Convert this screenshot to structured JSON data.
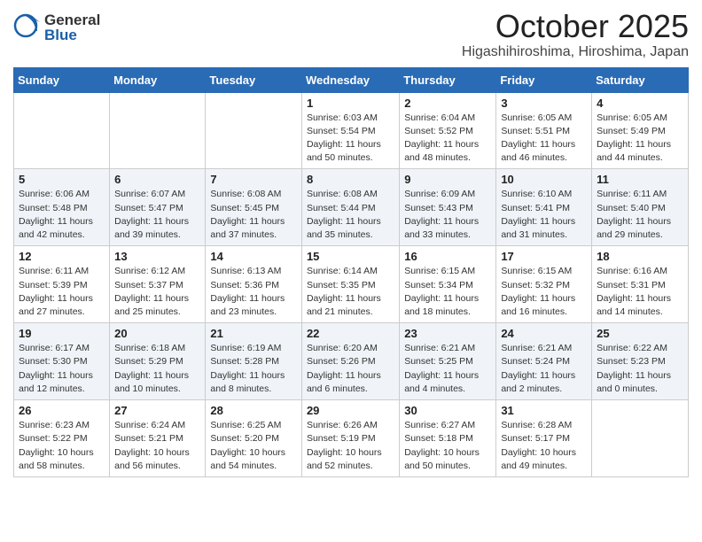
{
  "logo": {
    "general": "General",
    "blue": "Blue"
  },
  "title": "October 2025",
  "location": "Higashihiroshima, Hiroshima, Japan",
  "weekdays": [
    "Sunday",
    "Monday",
    "Tuesday",
    "Wednesday",
    "Thursday",
    "Friday",
    "Saturday"
  ],
  "weeks": [
    [
      {
        "day": "",
        "info": ""
      },
      {
        "day": "",
        "info": ""
      },
      {
        "day": "",
        "info": ""
      },
      {
        "day": "1",
        "info": "Sunrise: 6:03 AM\nSunset: 5:54 PM\nDaylight: 11 hours\nand 50 minutes."
      },
      {
        "day": "2",
        "info": "Sunrise: 6:04 AM\nSunset: 5:52 PM\nDaylight: 11 hours\nand 48 minutes."
      },
      {
        "day": "3",
        "info": "Sunrise: 6:05 AM\nSunset: 5:51 PM\nDaylight: 11 hours\nand 46 minutes."
      },
      {
        "day": "4",
        "info": "Sunrise: 6:05 AM\nSunset: 5:49 PM\nDaylight: 11 hours\nand 44 minutes."
      }
    ],
    [
      {
        "day": "5",
        "info": "Sunrise: 6:06 AM\nSunset: 5:48 PM\nDaylight: 11 hours\nand 42 minutes."
      },
      {
        "day": "6",
        "info": "Sunrise: 6:07 AM\nSunset: 5:47 PM\nDaylight: 11 hours\nand 39 minutes."
      },
      {
        "day": "7",
        "info": "Sunrise: 6:08 AM\nSunset: 5:45 PM\nDaylight: 11 hours\nand 37 minutes."
      },
      {
        "day": "8",
        "info": "Sunrise: 6:08 AM\nSunset: 5:44 PM\nDaylight: 11 hours\nand 35 minutes."
      },
      {
        "day": "9",
        "info": "Sunrise: 6:09 AM\nSunset: 5:43 PM\nDaylight: 11 hours\nand 33 minutes."
      },
      {
        "day": "10",
        "info": "Sunrise: 6:10 AM\nSunset: 5:41 PM\nDaylight: 11 hours\nand 31 minutes."
      },
      {
        "day": "11",
        "info": "Sunrise: 6:11 AM\nSunset: 5:40 PM\nDaylight: 11 hours\nand 29 minutes."
      }
    ],
    [
      {
        "day": "12",
        "info": "Sunrise: 6:11 AM\nSunset: 5:39 PM\nDaylight: 11 hours\nand 27 minutes."
      },
      {
        "day": "13",
        "info": "Sunrise: 6:12 AM\nSunset: 5:37 PM\nDaylight: 11 hours\nand 25 minutes."
      },
      {
        "day": "14",
        "info": "Sunrise: 6:13 AM\nSunset: 5:36 PM\nDaylight: 11 hours\nand 23 minutes."
      },
      {
        "day": "15",
        "info": "Sunrise: 6:14 AM\nSunset: 5:35 PM\nDaylight: 11 hours\nand 21 minutes."
      },
      {
        "day": "16",
        "info": "Sunrise: 6:15 AM\nSunset: 5:34 PM\nDaylight: 11 hours\nand 18 minutes."
      },
      {
        "day": "17",
        "info": "Sunrise: 6:15 AM\nSunset: 5:32 PM\nDaylight: 11 hours\nand 16 minutes."
      },
      {
        "day": "18",
        "info": "Sunrise: 6:16 AM\nSunset: 5:31 PM\nDaylight: 11 hours\nand 14 minutes."
      }
    ],
    [
      {
        "day": "19",
        "info": "Sunrise: 6:17 AM\nSunset: 5:30 PM\nDaylight: 11 hours\nand 12 minutes."
      },
      {
        "day": "20",
        "info": "Sunrise: 6:18 AM\nSunset: 5:29 PM\nDaylight: 11 hours\nand 10 minutes."
      },
      {
        "day": "21",
        "info": "Sunrise: 6:19 AM\nSunset: 5:28 PM\nDaylight: 11 hours\nand 8 minutes."
      },
      {
        "day": "22",
        "info": "Sunrise: 6:20 AM\nSunset: 5:26 PM\nDaylight: 11 hours\nand 6 minutes."
      },
      {
        "day": "23",
        "info": "Sunrise: 6:21 AM\nSunset: 5:25 PM\nDaylight: 11 hours\nand 4 minutes."
      },
      {
        "day": "24",
        "info": "Sunrise: 6:21 AM\nSunset: 5:24 PM\nDaylight: 11 hours\nand 2 minutes."
      },
      {
        "day": "25",
        "info": "Sunrise: 6:22 AM\nSunset: 5:23 PM\nDaylight: 11 hours\nand 0 minutes."
      }
    ],
    [
      {
        "day": "26",
        "info": "Sunrise: 6:23 AM\nSunset: 5:22 PM\nDaylight: 10 hours\nand 58 minutes."
      },
      {
        "day": "27",
        "info": "Sunrise: 6:24 AM\nSunset: 5:21 PM\nDaylight: 10 hours\nand 56 minutes."
      },
      {
        "day": "28",
        "info": "Sunrise: 6:25 AM\nSunset: 5:20 PM\nDaylight: 10 hours\nand 54 minutes."
      },
      {
        "day": "29",
        "info": "Sunrise: 6:26 AM\nSunset: 5:19 PM\nDaylight: 10 hours\nand 52 minutes."
      },
      {
        "day": "30",
        "info": "Sunrise: 6:27 AM\nSunset: 5:18 PM\nDaylight: 10 hours\nand 50 minutes."
      },
      {
        "day": "31",
        "info": "Sunrise: 6:28 AM\nSunset: 5:17 PM\nDaylight: 10 hours\nand 49 minutes."
      },
      {
        "day": "",
        "info": ""
      }
    ]
  ]
}
